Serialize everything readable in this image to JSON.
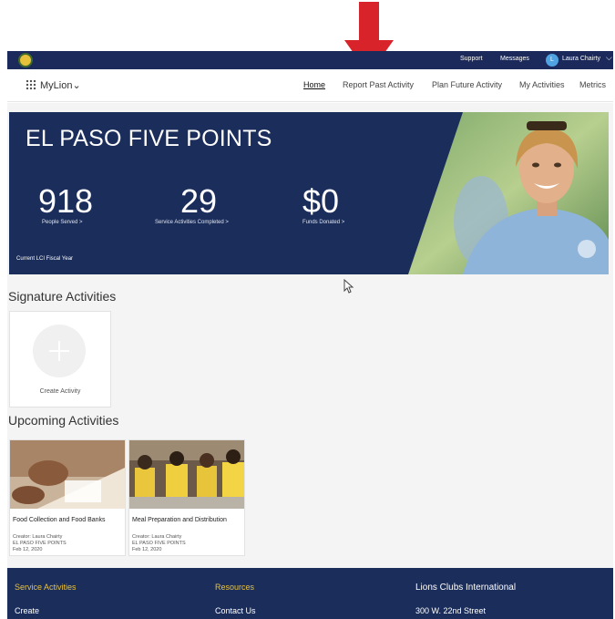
{
  "topbar": {
    "support": "Support",
    "messages": "Messages",
    "user_initial": "L",
    "user_name": "Laura Chairty"
  },
  "nav": {
    "brand": "MyLion",
    "items": [
      "Home",
      "Report Past Activity",
      "Plan Future Activity",
      "My Activities",
      "Metrics"
    ],
    "active": "Home"
  },
  "hero": {
    "title": "EL PASO FIVE POINTS",
    "stats": [
      {
        "value": "918",
        "label": "People Served >"
      },
      {
        "value": "29",
        "label": "Service Activities Completed >"
      },
      {
        "value": "$0",
        "label": "Funds Donated >"
      }
    ],
    "period": "Current LCI Fiscal Year"
  },
  "signature": {
    "title": "Signature Activities",
    "create_label": "Create Activity"
  },
  "upcoming": {
    "title": "Upcoming Activities",
    "cards": [
      {
        "title": "Food Collection and Food Banks",
        "creator": "Creator: Laura Chairty",
        "club": "EL PASO FIVE POINTS",
        "date": "Feb 12, 2020"
      },
      {
        "title": "Meal Preparation and Distribution",
        "creator": "Creator: Laura Chairty",
        "club": "EL PASO FIVE POINTS",
        "date": "Feb 12, 2020"
      }
    ]
  },
  "footer": {
    "col1": {
      "heading": "Service Activities",
      "link": "Create"
    },
    "col2": {
      "heading": "Resources",
      "link": "Contact Us"
    },
    "col3": {
      "heading": "Lions Clubs International",
      "link": "300 W. 22nd Street"
    }
  },
  "colors": {
    "navy": "#1b2d5b",
    "gold": "#e8c13a",
    "arrow_red": "#d8232a",
    "page_gray": "#f4f4f4"
  }
}
